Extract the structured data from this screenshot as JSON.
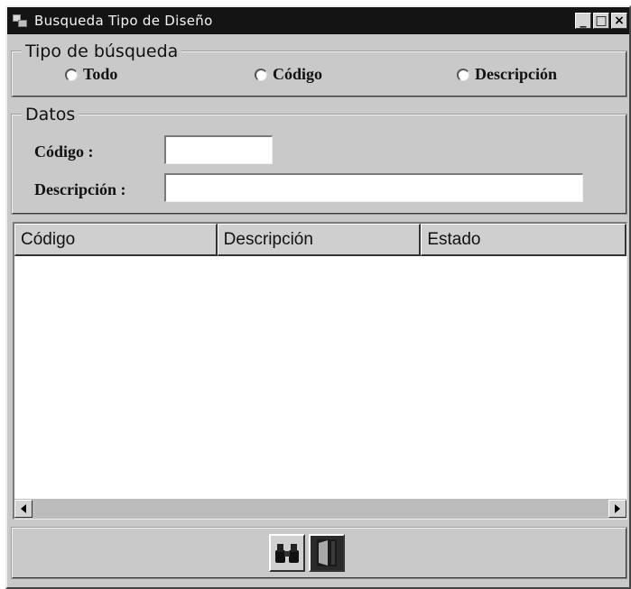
{
  "window": {
    "title": "Busqueda Tipo de Diseño",
    "minimize_glyph": "_",
    "maximize_glyph": "□",
    "close_glyph": "×"
  },
  "search_type": {
    "legend": "Tipo de búsqueda",
    "options": [
      "Todo",
      "Código",
      "Descripción"
    ]
  },
  "datos": {
    "legend": "Datos",
    "codigo_label": "Código :",
    "codigo_value": "",
    "descripcion_label": "Descripción :",
    "descripcion_value": ""
  },
  "results_table": {
    "columns": [
      "Código",
      "Descripción",
      "Estado"
    ],
    "rows": []
  },
  "toolbar": {
    "search_icon": "binoculars-icon",
    "exit_icon": "exit-door-icon"
  }
}
